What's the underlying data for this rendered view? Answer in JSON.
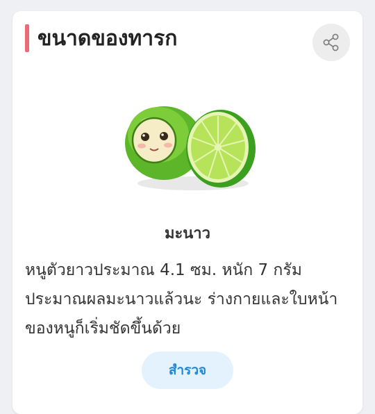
{
  "card": {
    "title": "ขนาดของทารก",
    "share_icon": "share-icon",
    "accent_color": "#ee6b76",
    "fruit_name": "มะนาว",
    "description": "หนูตัวยาวประมาณ 4.1 ซม. หนัก 7 กรัม ประมาณผลมะนาวแล้วนะ ร่างกายและใบหน้าของหนูก็เริ่มชัดขึ้นด้วย",
    "explore_label": "สำรวจ",
    "illustration_icon": "lime-fruit-icon"
  }
}
